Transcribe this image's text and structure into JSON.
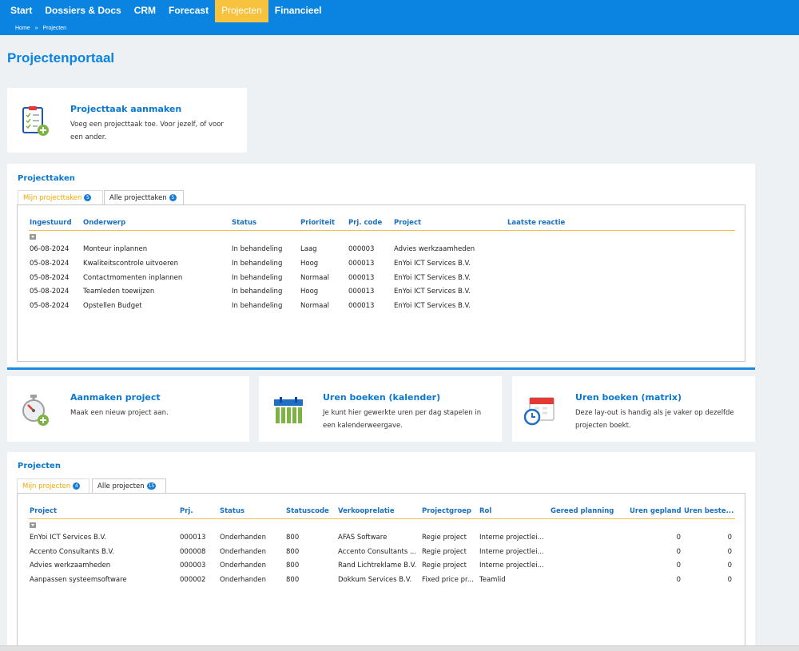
{
  "nav": {
    "items": [
      {
        "label": "Start",
        "active": false
      },
      {
        "label": "Dossiers & Docs",
        "active": false
      },
      {
        "label": "CRM",
        "active": false
      },
      {
        "label": "Forecast",
        "active": false
      },
      {
        "label": "Projecten",
        "active": true
      },
      {
        "label": "Financieel",
        "active": false
      }
    ]
  },
  "breadcrumb": {
    "home": "Home",
    "sep": "»",
    "current": "Projecten"
  },
  "page": {
    "title": "Projectenportaal"
  },
  "tiles": {
    "task": {
      "title": "Projecttaak aanmaken",
      "desc": "Voeg een projecttaak toe. Voor jezelf, of voor een ander.",
      "icon": "clipboard-add-icon"
    },
    "project": {
      "title": "Aanmaken project",
      "desc": "Maak een nieuw project aan.",
      "icon": "stopwatch-add-icon"
    },
    "calendar": {
      "title": "Uren boeken (kalender)",
      "desc": "Je kunt hier gewerkte uren per dag stapelen in een kalenderweergave.",
      "icon": "calendar-bars-icon"
    },
    "matrix": {
      "title": "Uren boeken (matrix)",
      "desc": "Deze lay-out is handig als je vaker op dezelfde projecten boekt.",
      "icon": "calendar-clock-icon"
    }
  },
  "tasks": {
    "title": "Projecttaken",
    "tabs": [
      {
        "label": "Mijn projecttaken",
        "count": "5"
      },
      {
        "label": "Alle projecttaken",
        "count": "5"
      }
    ],
    "columns": [
      "Ingestuurd",
      "Onderwerp",
      "Status",
      "Prioriteit",
      "Prj. code",
      "Project",
      "Laatste reactie"
    ],
    "rows": [
      [
        "06-08-2024",
        "Monteur inplannen",
        "In behandeling",
        "Laag",
        "000003",
        "Advies werkzaamheden",
        ""
      ],
      [
        "05-08-2024",
        "Kwaliteitscontrole uitvoeren",
        "In behandeling",
        "Hoog",
        "000013",
        "EnYoi ICT Services B.V.",
        ""
      ],
      [
        "05-08-2024",
        "Contactmomenten inplannen",
        "In behandeling",
        "Normaal",
        "000013",
        "EnYoi ICT Services B.V.",
        ""
      ],
      [
        "05-08-2024",
        "Teamleden toewijzen",
        "In behandeling",
        "Hoog",
        "000013",
        "EnYoi ICT Services B.V.",
        ""
      ],
      [
        "05-08-2024",
        "Opstellen Budget",
        "In behandeling",
        "Normaal",
        "000013",
        "EnYoi ICT Services B.V.",
        ""
      ]
    ]
  },
  "projects": {
    "title": "Projecten",
    "tabs": [
      {
        "label": "Mijn projecten",
        "count": "4"
      },
      {
        "label": "Alle projecten",
        "count": "15"
      }
    ],
    "columns": [
      "Project",
      "Prj.",
      "Status",
      "Statuscode",
      "Verkooprelatie",
      "Projectgroep",
      "Rol",
      "Gereed planning",
      "Uren gepland",
      "Uren beste..."
    ],
    "rows": [
      [
        "EnYoi ICT Services B.V.",
        "000013",
        "Onderhanden",
        "800",
        "AFAS Software",
        "Regie project",
        "Interne projectlei...",
        "",
        "0",
        "0"
      ],
      [
        "Accento Consultants B.V.",
        "000008",
        "Onderhanden",
        "800",
        "Accento Consultants ...",
        "Regie project",
        "Interne projectlei...",
        "",
        "0",
        "0"
      ],
      [
        "Advies werkzaamheden",
        "000003",
        "Onderhanden",
        "800",
        "Rand Lichtreklame B.V.",
        "Regie project",
        "Interne projectlei...",
        "",
        "0",
        "0"
      ],
      [
        "Aanpassen systeemsoftware",
        "000002",
        "Onderhanden",
        "800",
        "Dokkum Services B.V.",
        "Fixed price pr...",
        "Teamlid",
        "",
        "0",
        "0"
      ]
    ]
  }
}
